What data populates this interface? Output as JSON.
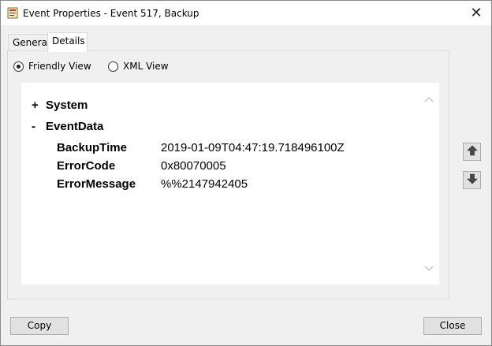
{
  "window": {
    "title": "Event Properties - Event 517, Backup",
    "close_glyph": "✕"
  },
  "tabs": [
    {
      "label": "General",
      "selected": false
    },
    {
      "label": "Details",
      "selected": true
    }
  ],
  "view_options": [
    {
      "label": "Friendly View",
      "checked": true
    },
    {
      "label": "XML View",
      "checked": false
    }
  ],
  "details": {
    "nodes": [
      {
        "toggle": "+",
        "label": "System"
      },
      {
        "toggle": "-",
        "label": "EventData"
      }
    ],
    "fields": [
      {
        "name": "BackupTime",
        "value": "2019-01-09T04:47:19.718496100Z"
      },
      {
        "name": "ErrorCode",
        "value": "0x80070005"
      },
      {
        "name": "ErrorMessage",
        "value": "%%2147942405"
      }
    ]
  },
  "icons": {
    "app": "event-viewer-icon",
    "move_up": "arrow-up-icon",
    "move_down": "arrow-down-icon",
    "scroll_up": "chevron-up-icon",
    "scroll_down": "chevron-down-icon"
  },
  "buttons": {
    "copy_label": "Copy",
    "close_label": "Close"
  }
}
